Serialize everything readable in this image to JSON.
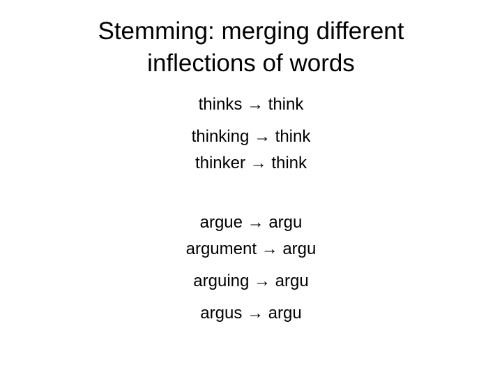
{
  "slide": {
    "title_lines": [
      "Stemming: merging different",
      "inflections of words"
    ],
    "items": [
      "thinks → think",
      "thinking → think",
      "thinker → think",
      "argue → argu",
      "argument → argu",
      "arguing → argu",
      "argus → argu"
    ]
  }
}
